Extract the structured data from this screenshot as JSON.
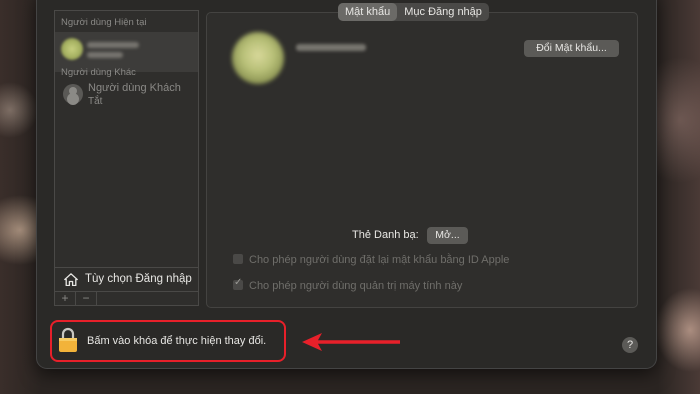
{
  "window": {
    "sidebar": {
      "current_section": "Người dùng Hiện tại",
      "other_section": "Người dùng Khác",
      "guest_name": "Người dùng Khách",
      "guest_status": "Tắt",
      "login_options": "Tùy chọn Đăng nhập",
      "add_label": "+",
      "remove_label": "−"
    },
    "tabs": [
      {
        "label": "Mật khẩu",
        "active": true
      },
      {
        "label": "Mục Đăng nhập",
        "active": false
      }
    ],
    "change_password_button": "Đổi Mật khẩu...",
    "contacts_card_label": "Thẻ Danh bạ:",
    "open_button": "Mở...",
    "checkboxes": [
      {
        "label": "Cho phép người dùng đặt lại mật khẩu bằng ID Apple",
        "checked": false
      },
      {
        "label": "Cho phép người dùng quản trị máy tính này",
        "checked": true
      }
    ],
    "lock_text": "Bấm vào khóa để thực hiện thay đổi.",
    "help_label": "?"
  },
  "annotation": {
    "color": "#e8202a"
  }
}
